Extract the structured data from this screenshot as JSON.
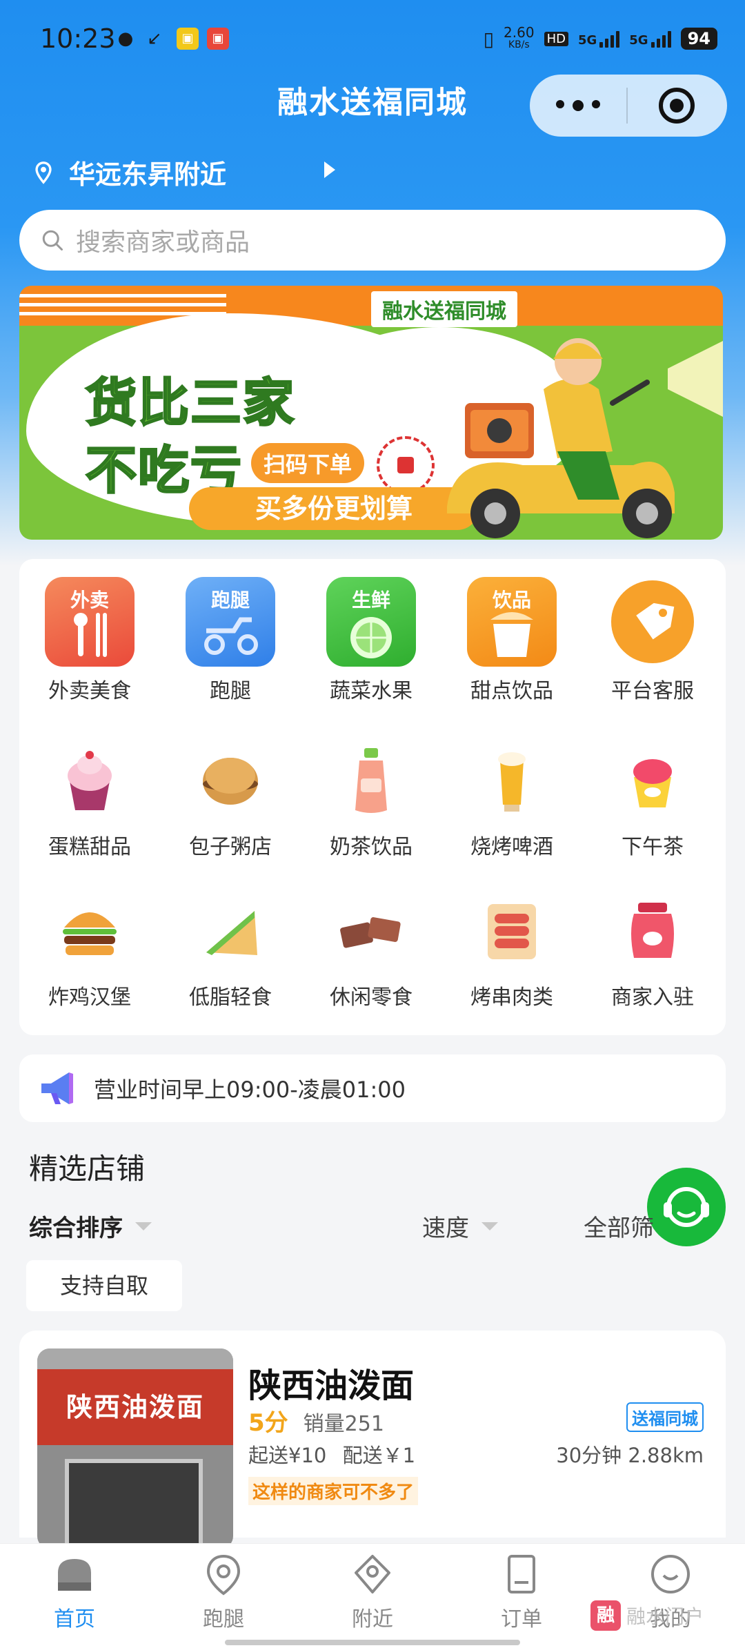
{
  "status_bar": {
    "time": "10:23",
    "net_speed_top": "2.60",
    "net_speed_bottom": "KB/s",
    "sim1": "5G",
    "sim2": "5G",
    "battery": "94"
  },
  "nav": {
    "title": "融水送福同城"
  },
  "location": {
    "text": "华远东昇附近"
  },
  "search": {
    "placeholder": "搜索商家或商品"
  },
  "banner": {
    "tag": "融水送福同城",
    "line1": "货比三家",
    "line2": "不吃亏",
    "scan": "扫码下单",
    "more": "买多份更划算"
  },
  "categories": [
    {
      "label": "外卖美食",
      "tile": "外卖",
      "icon": "takeout-icon",
      "color": "#f26a4c"
    },
    {
      "label": "跑腿",
      "tile": "跑腿",
      "icon": "errand-icon",
      "color": "#3f8ef0"
    },
    {
      "label": "蔬菜水果",
      "tile": "生鲜",
      "icon": "fresh-produce-icon",
      "color": "#3cbf3b"
    },
    {
      "label": "甜点饮品",
      "tile": "饮品",
      "icon": "drink-icon",
      "color": "#f59a1d"
    },
    {
      "label": "平台客服",
      "icon": "tag-icon",
      "color": "#f7a12a"
    },
    {
      "label": "蛋糕甜品",
      "icon": "cupcake-icon"
    },
    {
      "label": "包子粥店",
      "icon": "biscuit-icon"
    },
    {
      "label": "奶茶饮品",
      "icon": "bottle-icon"
    },
    {
      "label": "烧烤啤酒",
      "icon": "beer-icon"
    },
    {
      "label": "下午茶",
      "icon": "dessert-cup-icon"
    },
    {
      "label": "炸鸡汉堡",
      "icon": "burger-icon"
    },
    {
      "label": "低脂轻食",
      "icon": "sandwich-icon"
    },
    {
      "label": "休闲零食",
      "icon": "chocolate-icon"
    },
    {
      "label": "烤串肉类",
      "icon": "sausage-icon"
    },
    {
      "label": "商家入驻",
      "icon": "jar-icon"
    }
  ],
  "notice": {
    "text": "营业时间早上09:00-凌晨01:00"
  },
  "featured": {
    "title": "精选店铺",
    "sort_default": "综合排序",
    "sort_speed": "速度",
    "filter_all": "全部筛",
    "pickup": "支持自取"
  },
  "shop": {
    "sign": "陕西油泼面",
    "name": "陕西油泼面",
    "score": "5分",
    "sales": "销量251",
    "min_order": "起送¥10",
    "delivery_fee": "配送￥1",
    "badge": "送福同城",
    "eta_distance": "30分钟 2.88km",
    "tip": "这样的商家可不多了"
  },
  "tabbar": [
    {
      "label": "首页",
      "active": true
    },
    {
      "label": "跑腿",
      "active": false
    },
    {
      "label": "附近",
      "active": false
    },
    {
      "label": "订单",
      "active": false
    },
    {
      "label": "我的",
      "active": false
    }
  ],
  "watermark": {
    "logo": "融",
    "text": "融水门户"
  },
  "colors": {
    "brand_blue": "#1f8ef0",
    "fab_green": "#18b93b",
    "score_orange": "#f2a51b"
  }
}
